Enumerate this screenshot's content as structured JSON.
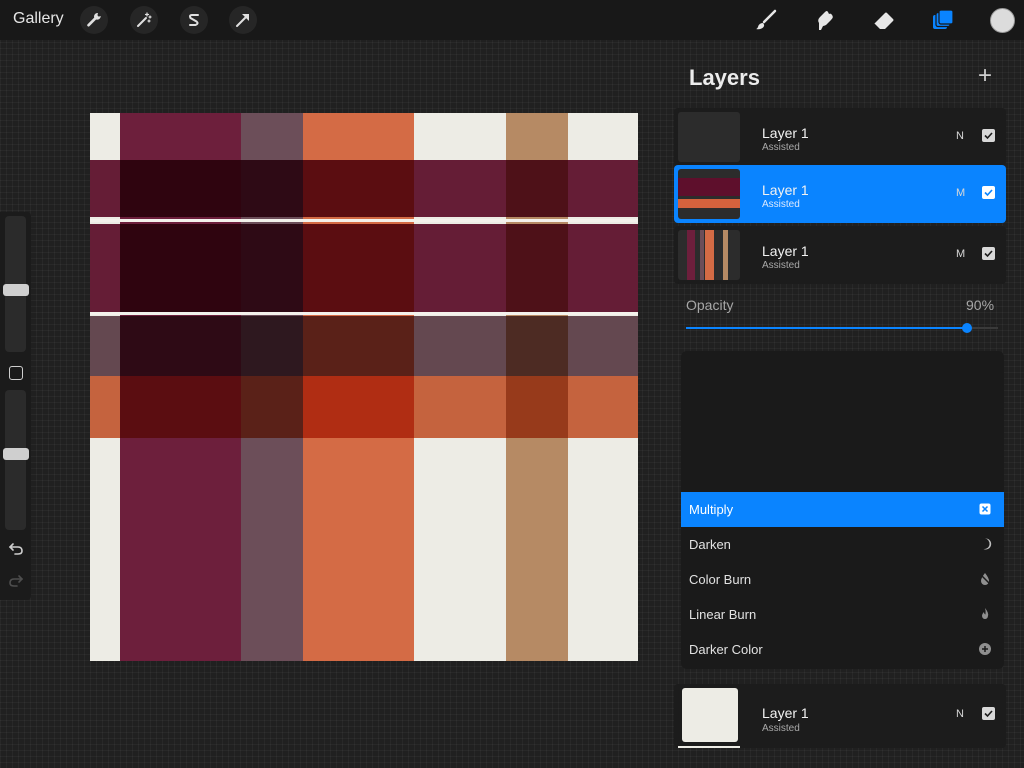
{
  "toolbar": {
    "gallery_label": "Gallery",
    "left_tools": [
      "wrench-icon",
      "magic-wand-icon",
      "selection-s-icon",
      "transform-arrow-icon"
    ],
    "right_tools": [
      "brush-icon",
      "smudge-icon",
      "eraser-icon",
      "layers-icon"
    ],
    "current_color": "#dcdcdc"
  },
  "sidebar": {
    "size_slider_level": 0.45,
    "opacity_slider_level": 0.55
  },
  "canvas": {
    "colors": {
      "cream": "#edece5",
      "burgundy": "#6d1f3c",
      "mauve": "#6c4e59",
      "orange": "#d46b45",
      "tan": "#b68a64"
    }
  },
  "layers": {
    "title": "Layers",
    "add_label": "+",
    "rows": [
      {
        "name": "Layer 1",
        "subtitle": "Assisted",
        "blend": "N",
        "visible": true,
        "selected": false
      },
      {
        "name": "Layer 1",
        "subtitle": "Assisted",
        "blend": "M",
        "visible": true,
        "selected": true
      },
      {
        "name": "Layer 1",
        "subtitle": "Assisted",
        "blend": "M",
        "visible": true,
        "selected": false
      }
    ],
    "opacity_label": "Opacity",
    "opacity_value": "90%",
    "opacity_fraction": 0.9,
    "blend_modes": [
      {
        "label": "Multiply",
        "icon": "close-square-icon",
        "active": true
      },
      {
        "label": "Darken",
        "icon": "moon-icon",
        "active": false
      },
      {
        "label": "Color Burn",
        "icon": "burn-drop-icon",
        "active": false
      },
      {
        "label": "Linear Burn",
        "icon": "flame-icon",
        "active": false
      },
      {
        "label": "Darker Color",
        "icon": "plus-circle-icon",
        "active": false
      }
    ],
    "background_row": {
      "name": "Layer 1",
      "subtitle": "Assisted",
      "blend": "N",
      "visible": true
    }
  }
}
